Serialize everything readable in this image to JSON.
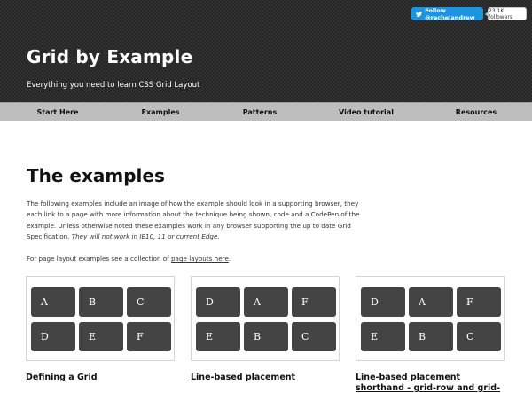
{
  "header": {
    "title": "Grid by Example",
    "tagline": "Everything you need to learn CSS Grid Layout"
  },
  "twitter": {
    "follow_label": "Follow @rachelandrew",
    "followers": "23.1K followers",
    "color": "#1b95e0"
  },
  "nav": {
    "items": [
      {
        "label": "Start Here"
      },
      {
        "label": "Examples"
      },
      {
        "label": "Patterns"
      },
      {
        "label": "Video tutorial"
      },
      {
        "label": "Resources"
      }
    ]
  },
  "main": {
    "title": "The examples",
    "intro_text": "The following examples include an image of how the example should look in a supporting browser, they each link to a page with more information about the technique being shown, code and a CodePen of the example. Unless otherwise noted these examples work in any browser supporting the up to date Grid Specification. ",
    "intro_note": "They will not work in IE10, 11 or current Edge.",
    "layout_text_before": "For page layout examples see a collection of ",
    "layout_link": "page layouts here",
    "layout_text_after": "."
  },
  "examples": [
    {
      "title": "Defining a Grid",
      "cells": [
        "A",
        "B",
        "C",
        "D",
        "E",
        "F"
      ]
    },
    {
      "title": "Line-based placement",
      "cells": [
        "D",
        "A",
        "F",
        "E",
        "B",
        "C"
      ]
    },
    {
      "title": "Line-based placement shorthand - grid-row and grid-",
      "cells": [
        "D",
        "A",
        "F",
        "E",
        "B",
        "C"
      ]
    }
  ],
  "colors": {
    "header_bg": "#2a2a2a",
    "nav_bg": "#b9b9b9",
    "cell_bg": "#444444"
  }
}
